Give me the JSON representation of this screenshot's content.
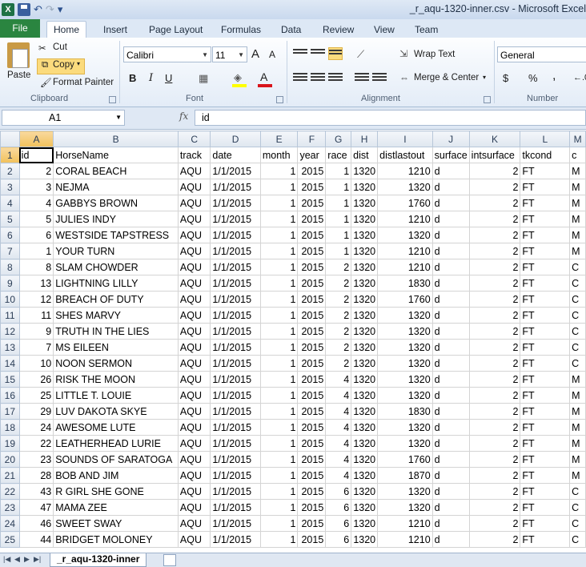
{
  "window": {
    "title": "_r_aqu-1320-inner.csv - Microsoft Excel"
  },
  "qat": {
    "app_icon": "X",
    "save_icon": "save-icon",
    "undo_glyph": "↶",
    "redo_glyph": "↷",
    "customize_glyph": "▾"
  },
  "ribbon_tabs": [
    "File",
    "Home",
    "Insert",
    "Page Layout",
    "Formulas",
    "Data",
    "Review",
    "View",
    "Team"
  ],
  "clipboard": {
    "paste": "Paste",
    "cut": "Cut",
    "copy": "Copy",
    "format_painter": "Format Painter",
    "group": "Clipboard"
  },
  "font": {
    "name": "Calibri",
    "size": "11",
    "grow": "A",
    "shrink": "A",
    "bold": "B",
    "italic": "I",
    "underline": "U",
    "group": "Font"
  },
  "alignment": {
    "wrap_text": "Wrap Text",
    "merge_center": "Merge & Center",
    "group": "Alignment"
  },
  "number": {
    "format": "General",
    "currency": "$",
    "percent": "%",
    "comma": ",",
    "group": "Number"
  },
  "formula_bar": {
    "name_box": "A1",
    "fx": "fx",
    "content": "id"
  },
  "columns": [
    "A",
    "B",
    "C",
    "D",
    "E",
    "F",
    "G",
    "H",
    "I",
    "J",
    "K",
    "L",
    "M"
  ],
  "header_row": [
    "id",
    "HorseName",
    "track",
    "date",
    "month",
    "year",
    "race",
    "dist",
    "distlastout",
    "surface",
    "intsurface",
    "tkcond",
    "c"
  ],
  "rows": [
    [
      "2",
      "CORAL BEACH",
      "AQU",
      "1/1/2015",
      "1",
      "2015",
      "1",
      "1320",
      "1210",
      "d",
      "2",
      "FT",
      "M"
    ],
    [
      "3",
      "NEJMA",
      "AQU",
      "1/1/2015",
      "1",
      "2015",
      "1",
      "1320",
      "1320",
      "d",
      "2",
      "FT",
      "M"
    ],
    [
      "4",
      "GABBYS BROWN",
      "AQU",
      "1/1/2015",
      "1",
      "2015",
      "1",
      "1320",
      "1760",
      "d",
      "2",
      "FT",
      "M"
    ],
    [
      "5",
      "JULIES INDY",
      "AQU",
      "1/1/2015",
      "1",
      "2015",
      "1",
      "1320",
      "1210",
      "d",
      "2",
      "FT",
      "M"
    ],
    [
      "6",
      "WESTSIDE TAPSTRESS",
      "AQU",
      "1/1/2015",
      "1",
      "2015",
      "1",
      "1320",
      "1320",
      "d",
      "2",
      "FT",
      "M"
    ],
    [
      "1",
      "YOUR TURN",
      "AQU",
      "1/1/2015",
      "1",
      "2015",
      "1",
      "1320",
      "1210",
      "d",
      "2",
      "FT",
      "M"
    ],
    [
      "8",
      "SLAM CHOWDER",
      "AQU",
      "1/1/2015",
      "1",
      "2015",
      "2",
      "1320",
      "1210",
      "d",
      "2",
      "FT",
      "C"
    ],
    [
      "13",
      "LIGHTNING LILLY",
      "AQU",
      "1/1/2015",
      "1",
      "2015",
      "2",
      "1320",
      "1830",
      "d",
      "2",
      "FT",
      "C"
    ],
    [
      "12",
      "BREACH OF DUTY",
      "AQU",
      "1/1/2015",
      "1",
      "2015",
      "2",
      "1320",
      "1760",
      "d",
      "2",
      "FT",
      "C"
    ],
    [
      "11",
      "SHES MARVY",
      "AQU",
      "1/1/2015",
      "1",
      "2015",
      "2",
      "1320",
      "1320",
      "d",
      "2",
      "FT",
      "C"
    ],
    [
      "9",
      "TRUTH IN THE LIES",
      "AQU",
      "1/1/2015",
      "1",
      "2015",
      "2",
      "1320",
      "1320",
      "d",
      "2",
      "FT",
      "C"
    ],
    [
      "7",
      "MS EILEEN",
      "AQU",
      "1/1/2015",
      "1",
      "2015",
      "2",
      "1320",
      "1320",
      "d",
      "2",
      "FT",
      "C"
    ],
    [
      "10",
      "NOON SERMON",
      "AQU",
      "1/1/2015",
      "1",
      "2015",
      "2",
      "1320",
      "1320",
      "d",
      "2",
      "FT",
      "C"
    ],
    [
      "26",
      "RISK THE MOON",
      "AQU",
      "1/1/2015",
      "1",
      "2015",
      "4",
      "1320",
      "1320",
      "d",
      "2",
      "FT",
      "M"
    ],
    [
      "25",
      "LITTLE T. LOUIE",
      "AQU",
      "1/1/2015",
      "1",
      "2015",
      "4",
      "1320",
      "1320",
      "d",
      "2",
      "FT",
      "M"
    ],
    [
      "29",
      "LUV DAKOTA SKYE",
      "AQU",
      "1/1/2015",
      "1",
      "2015",
      "4",
      "1320",
      "1830",
      "d",
      "2",
      "FT",
      "M"
    ],
    [
      "24",
      "AWESOME LUTE",
      "AQU",
      "1/1/2015",
      "1",
      "2015",
      "4",
      "1320",
      "1320",
      "d",
      "2",
      "FT",
      "M"
    ],
    [
      "22",
      "LEATHERHEAD LURIE",
      "AQU",
      "1/1/2015",
      "1",
      "2015",
      "4",
      "1320",
      "1320",
      "d",
      "2",
      "FT",
      "M"
    ],
    [
      "23",
      "SOUNDS OF SARATOGA",
      "AQU",
      "1/1/2015",
      "1",
      "2015",
      "4",
      "1320",
      "1760",
      "d",
      "2",
      "FT",
      "M"
    ],
    [
      "28",
      "BOB AND JIM",
      "AQU",
      "1/1/2015",
      "1",
      "2015",
      "4",
      "1320",
      "1870",
      "d",
      "2",
      "FT",
      "M"
    ],
    [
      "43",
      "R GIRL SHE GONE",
      "AQU",
      "1/1/2015",
      "1",
      "2015",
      "6",
      "1320",
      "1320",
      "d",
      "2",
      "FT",
      "C"
    ],
    [
      "47",
      "MAMA ZEE",
      "AQU",
      "1/1/2015",
      "1",
      "2015",
      "6",
      "1320",
      "1320",
      "d",
      "2",
      "FT",
      "C"
    ],
    [
      "46",
      "SWEET SWAY",
      "AQU",
      "1/1/2015",
      "1",
      "2015",
      "6",
      "1320",
      "1210",
      "d",
      "2",
      "FT",
      "C"
    ],
    [
      "44",
      "BRIDGET MOLONEY",
      "AQU",
      "1/1/2015",
      "1",
      "2015",
      "6",
      "1320",
      "1210",
      "d",
      "2",
      "FT",
      "C"
    ]
  ],
  "sheet_tabs": {
    "active": "_r_aqu-1320-inner"
  }
}
